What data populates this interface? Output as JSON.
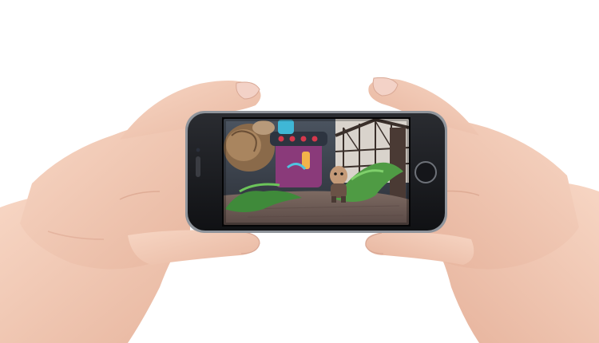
{
  "scene": {
    "description_kind": "photo",
    "background_color": "#ffffff",
    "skin_color": "#f2c9b3",
    "phone_body_color": "#1a1b1f",
    "phone_edge_color": "#8f949b",
    "game_palette": {
      "sky": "#3a3f48",
      "ground": "#6b5a55",
      "foliage": "#3f8a3a",
      "machine": "#8a3a7a",
      "accent": "#f2b24a",
      "building": "#d9d3cc"
    }
  }
}
